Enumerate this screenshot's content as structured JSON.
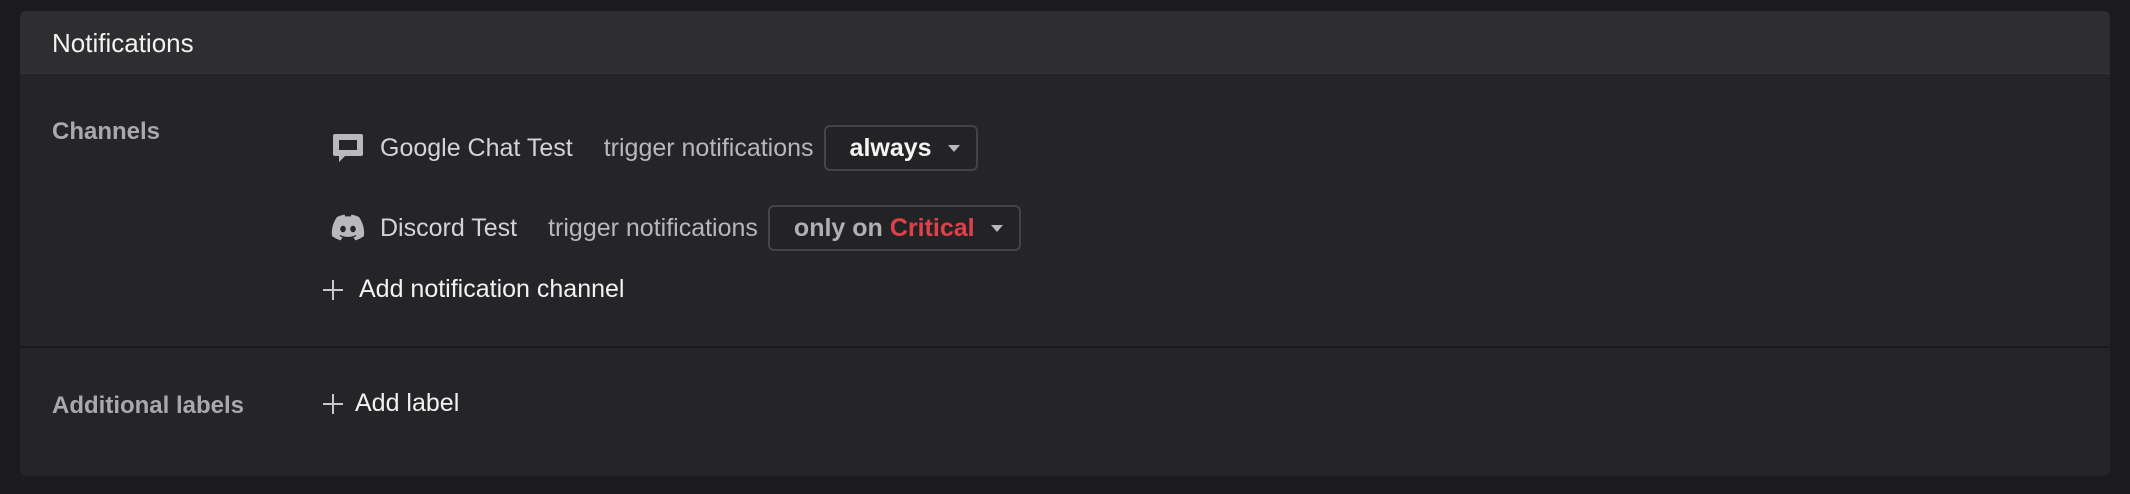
{
  "panel": {
    "title": "Notifications"
  },
  "channels_section": {
    "label": "Channels",
    "channels": [
      {
        "icon": "google-chat-icon",
        "name": "Google Chat Test",
        "trigger_text": "trigger notifications",
        "select_value": "always"
      },
      {
        "icon": "discord-icon",
        "name": "Discord Test",
        "trigger_text": "trigger notifications",
        "select_prefix": "only on",
        "select_severity": "Critical"
      }
    ],
    "add_channel_label": "Add notification channel"
  },
  "labels_section": {
    "label": "Additional labels",
    "add_label": "Add label"
  },
  "colors": {
    "critical": "#e0404a",
    "panel_bg": "#252528",
    "header_bg": "#2e2e31"
  }
}
